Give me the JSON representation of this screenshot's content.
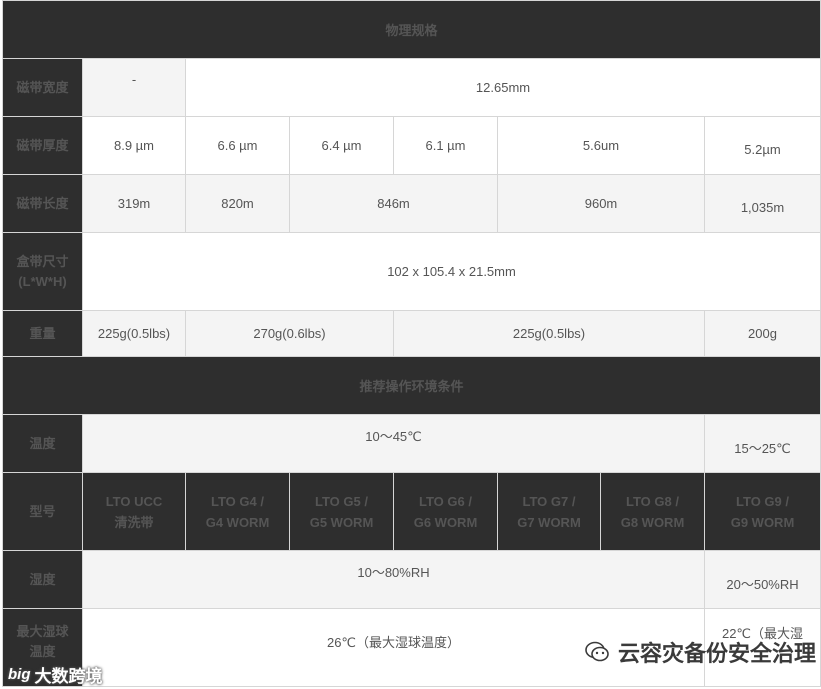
{
  "sections": {
    "physical": "物理规格",
    "environment": "推荐操作环境条件"
  },
  "rows": {
    "tape_width": {
      "label": "磁带宽度",
      "c1": "-",
      "c2": "12.65mm"
    },
    "tape_thickness": {
      "label": "磁带厚度",
      "c1": "8.9 µm",
      "c2": "6.6 µm",
      "c3": "6.4 µm",
      "c4": "6.1 µm",
      "c5": "5.6um",
      "c6": "5.2µm"
    },
    "tape_length": {
      "label": "磁带长度",
      "c1": "319m",
      "c2": "820m",
      "c3": "846m",
      "c4": "960m",
      "c5": "1,035m"
    },
    "cartridge_size": {
      "label_line1": "盒带尺寸",
      "label_line2": "(L*W*H)",
      "value": "102 x 105.4 x 21.5mm"
    },
    "weight": {
      "label": "重量",
      "c1": "225g(0.5lbs)",
      "c2": "270g(0.6lbs)",
      "c3": "225g(0.5lbs)",
      "c4": "200g"
    },
    "temperature": {
      "label": "温度",
      "c1": "10～45℃",
      "c2": "15～25℃"
    },
    "model": {
      "label": "型号",
      "items": [
        {
          "line1": "LTO UCC",
          "line2": "清洗带"
        },
        {
          "line1": "LTO G4 /",
          "line2": "G4 WORM"
        },
        {
          "line1": "LTO G5 /",
          "line2": "G5 WORM"
        },
        {
          "line1": "LTO G6 /",
          "line2": "G6 WORM"
        },
        {
          "line1": "LTO G7 /",
          "line2": "G7 WORM"
        },
        {
          "line1": "LTO G8 /",
          "line2": "G8 WORM"
        },
        {
          "line1": "LTO G9 /",
          "line2": "G9 WORM"
        }
      ]
    },
    "humidity": {
      "label": "湿度",
      "c1": "10～80%RH",
      "c2": "20～50%RH"
    },
    "wet_bulb": {
      "label_line1": "最大湿球",
      "label_line2": "温度",
      "c1": "26℃（最大湿球温度）",
      "c2": "22℃（最大湿"
    }
  },
  "watermarks": {
    "right": "云容灾备份安全治理",
    "left_logo": "big",
    "left": "大数跨境"
  }
}
